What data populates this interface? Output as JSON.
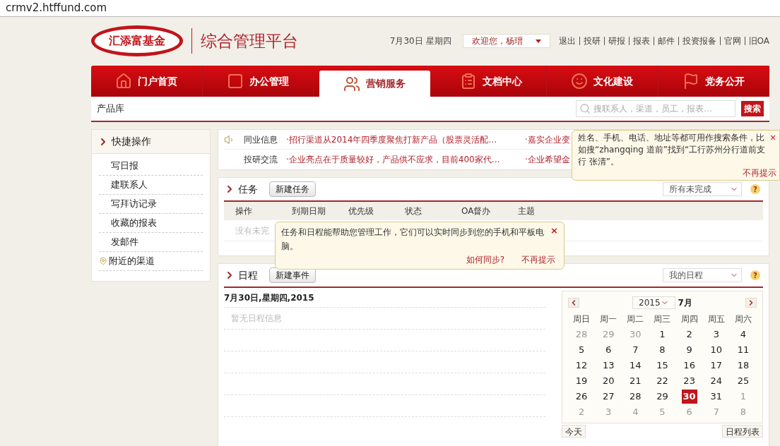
{
  "address_bar": {
    "url": "crmv2.htffund.com"
  },
  "header": {
    "logo_text": "汇添富基金",
    "platform_title": "综合管理平台",
    "date": "7月30日 星期四",
    "user_menu": "欢迎您，杨瑨",
    "links": [
      "退出",
      "投研",
      "研报",
      "报表",
      "邮件",
      "投资报备",
      "官网",
      "旧OA"
    ]
  },
  "nav_tabs": [
    {
      "label": "门户首页",
      "kind": "home",
      "selected": false
    },
    {
      "label": "办公管理",
      "kind": "office",
      "selected": false
    },
    {
      "label": "营销服务",
      "kind": "people",
      "selected": true
    },
    {
      "label": "文档中心",
      "kind": "docs",
      "selected": false
    },
    {
      "label": "文化建设",
      "kind": "culture",
      "selected": false
    },
    {
      "label": "党务公开",
      "kind": "party",
      "selected": false
    }
  ],
  "breadcrumb": "产品库",
  "search": {
    "placeholder": "搜联系人，渠道，员工，报表…",
    "button": "搜索"
  },
  "search_tip": {
    "text": "姓名、手机、电话、地址等都可用作搜索条件，比如搜“zhangqing 道前”找到“工行苏州分行道前支行 张清”。",
    "dismiss": "不再提示",
    "close": "×"
  },
  "sidebar": {
    "title": "快捷操作",
    "items": [
      {
        "label": "写日报",
        "kind": "plain"
      },
      {
        "label": "建联系人",
        "kind": "plain"
      },
      {
        "label": "写拜访记录",
        "kind": "plain"
      },
      {
        "label": "收藏的报表",
        "kind": "plain"
      },
      {
        "label": "发邮件",
        "kind": "plain"
      },
      {
        "label": "附近的渠道",
        "kind": "location"
      }
    ]
  },
  "news": [
    {
      "category": "同业信息",
      "items": [
        "·招行渠道从2014年四季度聚焦打新产品（股票灵活配…",
        "·嘉实企业变"
      ]
    },
    {
      "category": "投研交流",
      "items": [
        "·企业亮点在于质量较好，产品供不应求，目前400家代…",
        "·企业希望金"
      ]
    }
  ],
  "tasks": {
    "title": "任务",
    "new_button": "新建任务",
    "filter": "所有未完成",
    "help": "?",
    "columns": [
      "操作",
      "到期日期",
      "优先级",
      "状态",
      "OA督办",
      "主题"
    ],
    "empty": "没有未完",
    "tip": {
      "text": "任务和日程能帮助您管理工作，它们可以实时同步到您的手机和平板电脑。",
      "how_link": "如何同步?",
      "dismiss": "不再提示",
      "close": "×"
    }
  },
  "schedule": {
    "title": "日程",
    "new_button": "新建事件",
    "filter": "我的日程",
    "help": "?",
    "date": "7月30日,星期四,2015",
    "empty": "暂无日程信息",
    "calendar": {
      "year": "2015",
      "month": "7月",
      "weekdays": [
        "周日",
        "周一",
        "周二",
        "周三",
        "周四",
        "周五",
        "周六"
      ],
      "weeks": [
        [
          {
            "day": "28",
            "in_month": false,
            "selected": false
          },
          {
            "day": "29",
            "in_month": false,
            "selected": false
          },
          {
            "day": "30",
            "in_month": false,
            "selected": false
          },
          {
            "day": "1",
            "in_month": true,
            "selected": false
          },
          {
            "day": "2",
            "in_month": true,
            "selected": false
          },
          {
            "day": "3",
            "in_month": true,
            "selected": false
          },
          {
            "day": "4",
            "in_month": true,
            "selected": false
          }
        ],
        [
          {
            "day": "5",
            "in_month": true,
            "selected": false
          },
          {
            "day": "6",
            "in_month": true,
            "selected": false
          },
          {
            "day": "7",
            "in_month": true,
            "selected": false
          },
          {
            "day": "8",
            "in_month": true,
            "selected": false
          },
          {
            "day": "9",
            "in_month": true,
            "selected": false
          },
          {
            "day": "10",
            "in_month": true,
            "selected": false
          },
          {
            "day": "11",
            "in_month": true,
            "selected": false
          }
        ],
        [
          {
            "day": "12",
            "in_month": true,
            "selected": false
          },
          {
            "day": "13",
            "in_month": true,
            "selected": false
          },
          {
            "day": "14",
            "in_month": true,
            "selected": false
          },
          {
            "day": "15",
            "in_month": true,
            "selected": false
          },
          {
            "day": "16",
            "in_month": true,
            "selected": false
          },
          {
            "day": "17",
            "in_month": true,
            "selected": false
          },
          {
            "day": "18",
            "in_month": true,
            "selected": false
          }
        ],
        [
          {
            "day": "19",
            "in_month": true,
            "selected": false
          },
          {
            "day": "20",
            "in_month": true,
            "selected": false
          },
          {
            "day": "21",
            "in_month": true,
            "selected": false
          },
          {
            "day": "22",
            "in_month": true,
            "selected": false
          },
          {
            "day": "23",
            "in_month": true,
            "selected": false
          },
          {
            "day": "24",
            "in_month": true,
            "selected": false
          },
          {
            "day": "25",
            "in_month": true,
            "selected": false
          }
        ],
        [
          {
            "day": "26",
            "in_month": true,
            "selected": false
          },
          {
            "day": "27",
            "in_month": true,
            "selected": false
          },
          {
            "day": "28",
            "in_month": true,
            "selected": false
          },
          {
            "day": "29",
            "in_month": true,
            "selected": false
          },
          {
            "day": "30",
            "in_month": true,
            "selected": true
          },
          {
            "day": "31",
            "in_month": true,
            "selected": false
          },
          {
            "day": "1",
            "in_month": false,
            "selected": false
          }
        ],
        [
          {
            "day": "2",
            "in_month": false,
            "selected": false
          },
          {
            "day": "3",
            "in_month": false,
            "selected": false
          },
          {
            "day": "4",
            "in_month": false,
            "selected": false
          },
          {
            "day": "5",
            "in_month": false,
            "selected": false
          },
          {
            "day": "6",
            "in_month": false,
            "selected": false
          },
          {
            "day": "7",
            "in_month": false,
            "selected": false
          },
          {
            "day": "8",
            "in_month": false,
            "selected": false
          }
        ]
      ],
      "today_button": "今天",
      "list_button": "日程列表"
    }
  }
}
